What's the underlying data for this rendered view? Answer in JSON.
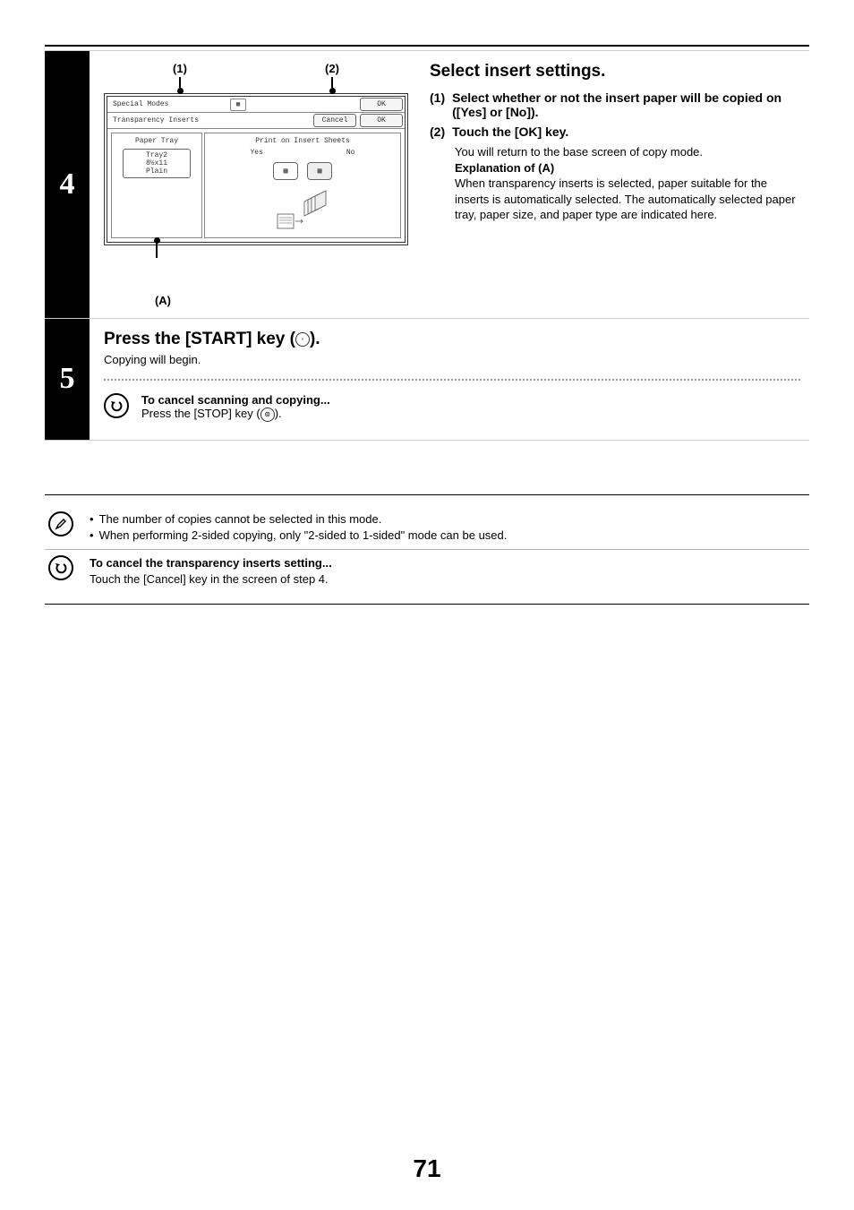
{
  "step4": {
    "number": "4",
    "callout1": "(1)",
    "callout2": "(2)",
    "calloutA": "(A)",
    "screen": {
      "specialModes": "Special Modes",
      "transparencyInserts": "Transparency Inserts",
      "cancel": "Cancel",
      "ok": "OK",
      "paperTray": "Paper Tray",
      "printOnInsert": "Print on Insert Sheets",
      "yes": "Yes",
      "no": "No",
      "tray": "Tray2",
      "size": "8½x11",
      "type": "Plain"
    },
    "title": "Select insert settings.",
    "item1_num": "(1)",
    "item1_text": "Select whether or not the insert paper will be copied on ([Yes] or [No]).",
    "item2_num": "(2)",
    "item2_text": "Touch the [OK] key.",
    "item2_explain_line1": "You will return to the base screen of copy mode.",
    "item2_explain_heading": "Explanation of (A)",
    "item2_explain_body": "When transparency inserts is selected, paper suitable for the inserts is automatically selected. The automatically selected paper tray, paper size, and paper type are indicated here."
  },
  "step5": {
    "number": "5",
    "title_prefix": "Press the [START] key (",
    "title_suffix": ").",
    "sub": "Copying will begin.",
    "cancel_heading": "To cancel scanning and copying...",
    "cancel_body_prefix": "Press the [STOP] key (",
    "cancel_body_suffix": ")."
  },
  "notes": {
    "bullet1": "The number of copies cannot be selected in this mode.",
    "bullet2": "When performing 2-sided copying, only \"2-sided to 1-sided\" mode can be used.",
    "cancel_heading": "To cancel the transparency inserts setting...",
    "cancel_body": "Touch the [Cancel] key in the screen of step 4."
  },
  "pageNumber": "71"
}
